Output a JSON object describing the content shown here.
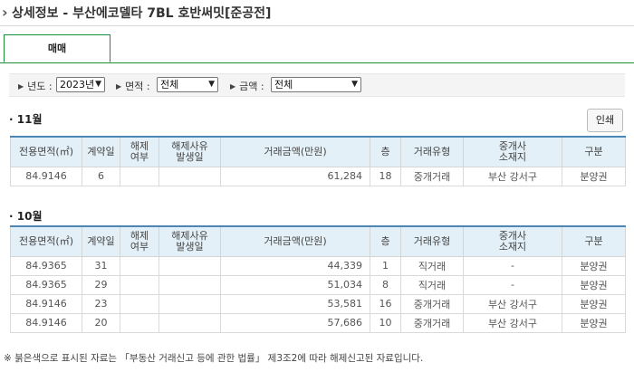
{
  "header": {
    "title": "상세정보 - 부산에코델타 7BL 호반써밋[준공전]"
  },
  "tabs": [
    {
      "label": "매매"
    }
  ],
  "filters": {
    "year_label": "년도 :",
    "year_value": "2023년",
    "area_label": "면적 :",
    "area_value": "전체",
    "price_label": "금액 :",
    "price_value": "전체"
  },
  "print_label": "인쇄",
  "columns": [
    "전용면적(㎡)",
    "계약일",
    "해제\n여부",
    "해제사유\n발생일",
    "거래금액(만원)",
    "층",
    "거래유형",
    "중개사\n소재지",
    "구분"
  ],
  "sections": [
    {
      "title": "11월",
      "rows": [
        [
          "84.9146",
          "6",
          "",
          "",
          "61,284",
          "18",
          "중개거래",
          "부산 강서구",
          "분양권"
        ]
      ]
    },
    {
      "title": "10월",
      "rows": [
        [
          "84.9365",
          "31",
          "",
          "",
          "44,339",
          "1",
          "직거래",
          "-",
          "분양권"
        ],
        [
          "84.9365",
          "29",
          "",
          "",
          "51,034",
          "8",
          "직거래",
          "-",
          "분양권"
        ],
        [
          "84.9146",
          "23",
          "",
          "",
          "53,581",
          "16",
          "중개거래",
          "부산 강서구",
          "분양권"
        ],
        [
          "84.9146",
          "20",
          "",
          "",
          "57,686",
          "10",
          "중개거래",
          "부산 강서구",
          "분양권"
        ]
      ]
    }
  ],
  "footnote": "※ 붉은색으로 표시된 자료는 「부동산 거래신고 등에 관한 법률」 제3조2에 따라 해제신고된 자료입니다."
}
